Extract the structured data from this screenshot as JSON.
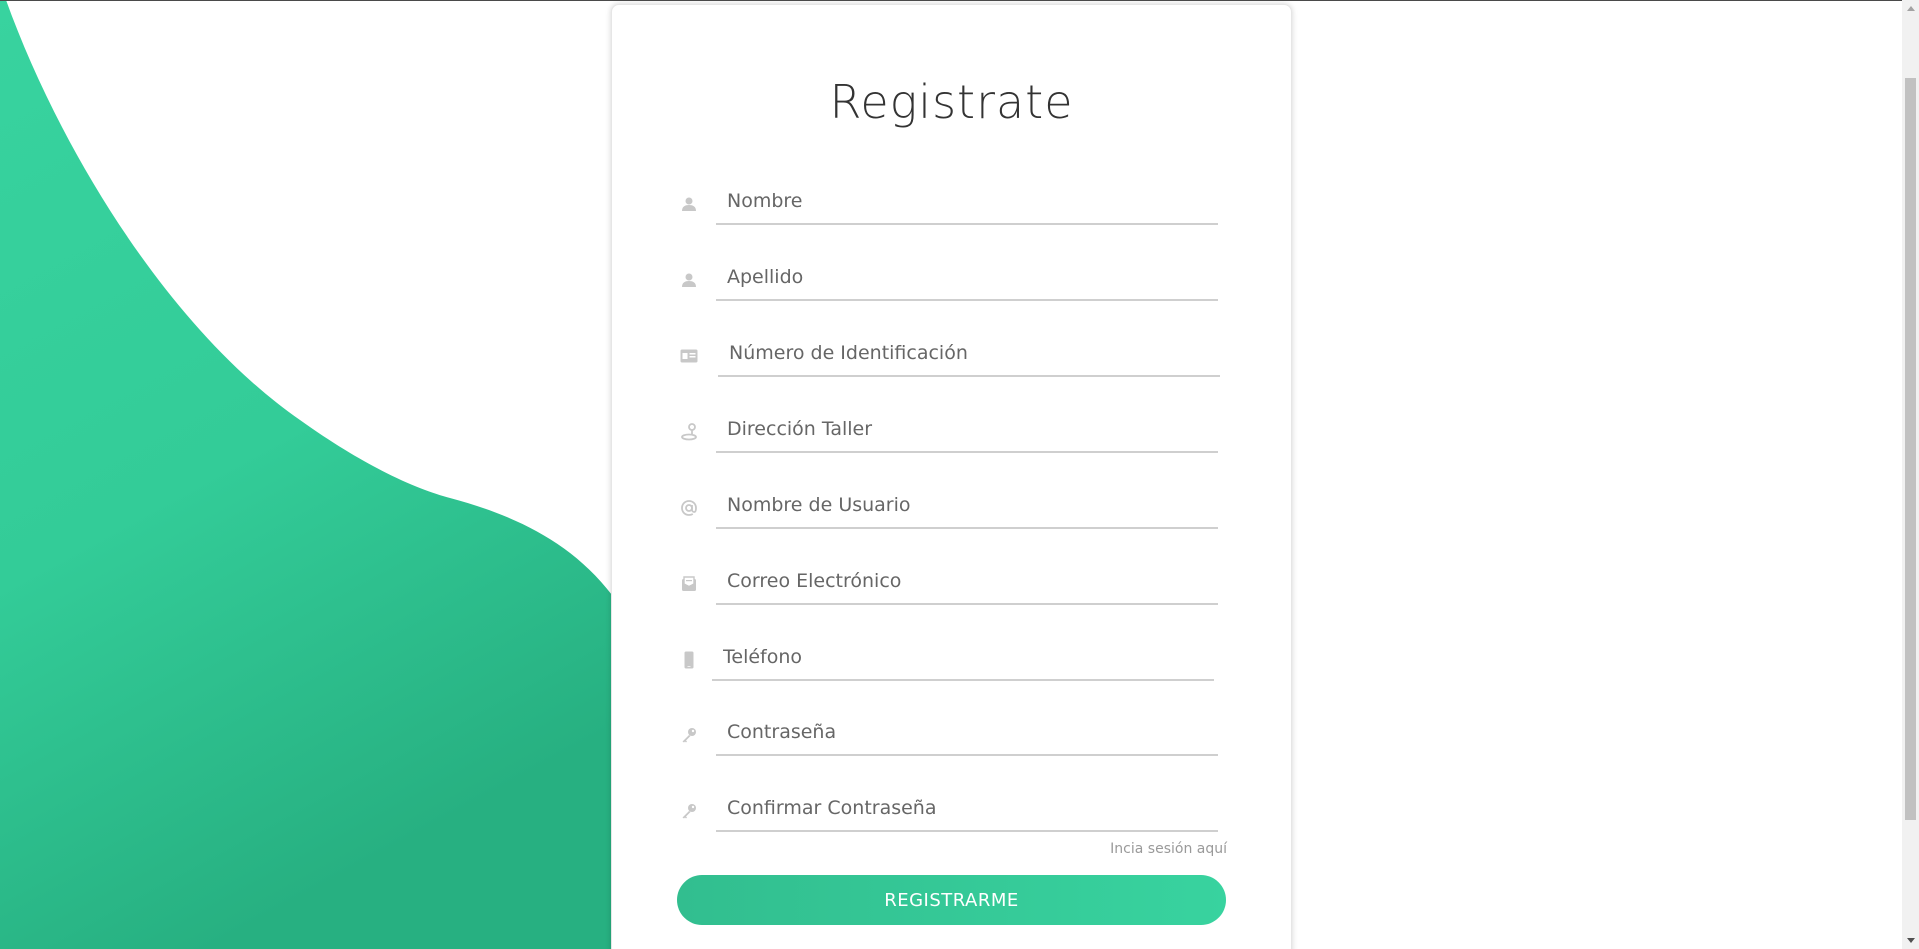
{
  "form": {
    "title": "Registrate",
    "fields": [
      {
        "placeholder": "Nombre",
        "icon": "user-icon"
      },
      {
        "placeholder": "Apellido",
        "icon": "user-icon"
      },
      {
        "placeholder": "Número de Identificación",
        "icon": "id-card-icon"
      },
      {
        "placeholder": "Dirección Taller",
        "icon": "map-pin-icon"
      },
      {
        "placeholder": "Nombre de Usuario",
        "icon": "at-sign-icon"
      },
      {
        "placeholder": "Correo Electrónico",
        "icon": "envelope-icon"
      },
      {
        "placeholder": "Teléfono",
        "icon": "phone-icon"
      },
      {
        "placeholder": "Contraseña",
        "icon": "key-icon"
      },
      {
        "placeholder": "Confirmar Contraseña",
        "icon": "key-icon"
      }
    ],
    "login_link": "Incia sesión aquí",
    "submit_label": "REGISTRARME"
  },
  "colors": {
    "accent_start": "#32be8f",
    "accent_end": "#38d39f",
    "icon_gray": "#c8c8c8",
    "title": "#333333"
  }
}
